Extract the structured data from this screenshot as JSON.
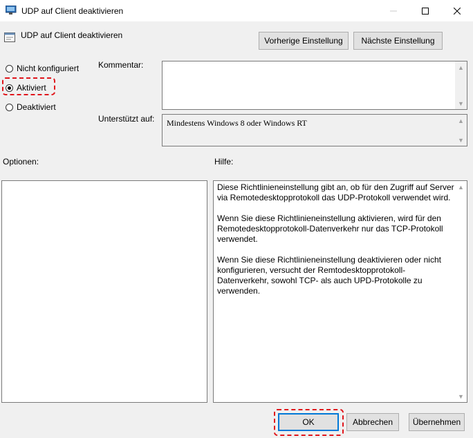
{
  "window": {
    "title": "UDP auf Client deaktivieren"
  },
  "header": {
    "policy_name": "UDP auf Client deaktivieren",
    "prev_button": "Vorherige Einstellung",
    "next_button": "Nächste Einstellung"
  },
  "state": {
    "options": [
      {
        "label": "Nicht konfiguriert",
        "selected": false
      },
      {
        "label": "Aktiviert",
        "selected": true
      },
      {
        "label": "Deaktiviert",
        "selected": false
      }
    ]
  },
  "comment": {
    "label": "Kommentar:",
    "value": ""
  },
  "supported": {
    "label": "Unterstützt auf:",
    "value": "Mindestens Windows 8 oder Windows RT"
  },
  "options_pane": {
    "label": "Optionen:"
  },
  "help_pane": {
    "label": "Hilfe:",
    "paragraphs": [
      "Diese Richtlinieneinstellung gibt an, ob für den Zugriff auf Server via Remotedesktopprotokoll das UDP-Protokoll verwendet wird.",
      "Wenn Sie diese Richtlinieneinstellung aktivieren, wird für den Remotedesktopprotokoll-Datenverkehr nur das TCP-Protokoll verwendet.",
      "Wenn Sie diese Richtlinieneinstellung deaktivieren oder nicht konfigurieren, versucht der Remtodesktopprotokoll-Datenverkehr, sowohl TCP- als auch UPD-Protokolle zu verwenden."
    ]
  },
  "footer": {
    "ok": "OK",
    "cancel": "Abbrechen",
    "apply": "Übernehmen"
  },
  "colors": {
    "highlight": "#e0151b",
    "ok_border": "#0078d7"
  }
}
